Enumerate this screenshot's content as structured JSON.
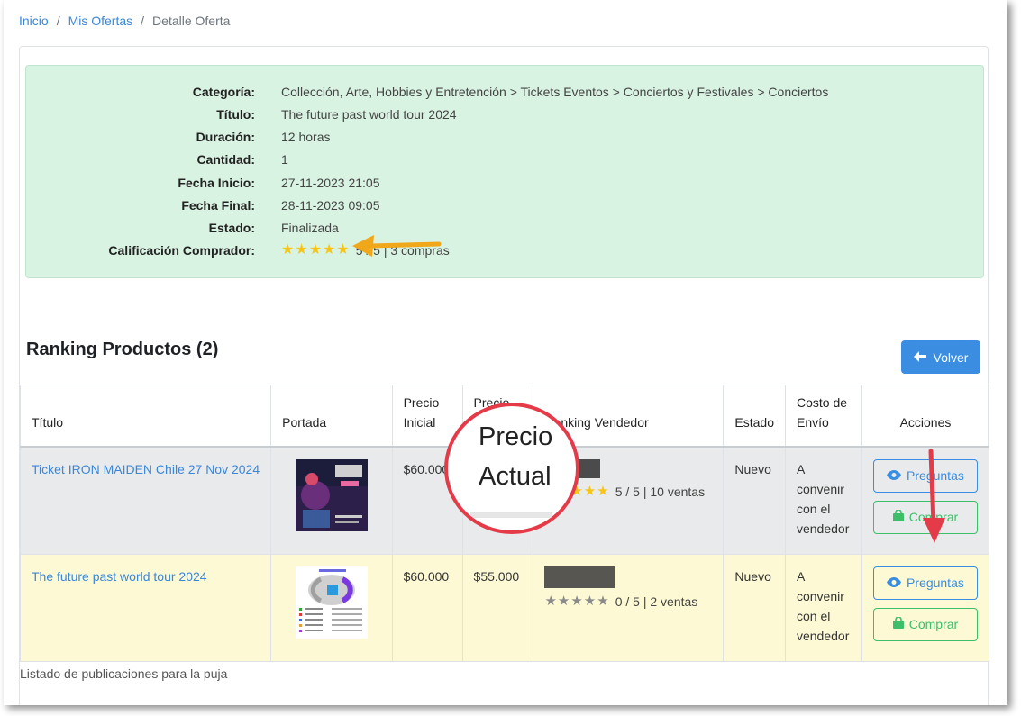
{
  "breadcrumb": {
    "home": "Inicio",
    "offers": "Mis Ofertas",
    "current": "Detalle Oferta"
  },
  "detail": {
    "rows": [
      {
        "label": "Categoría:",
        "value": "Collección, Arte, Hobbies y Entretención > Tickets Eventos > Conciertos y Festivales > Conciertos"
      },
      {
        "label": "Título:",
        "value": "The future past world tour 2024"
      },
      {
        "label": "Duración:",
        "value": "12 horas"
      },
      {
        "label": "Cantidad:",
        "value": "1"
      },
      {
        "label": "Fecha Inicio:",
        "value": "27-11-2023 21:05"
      },
      {
        "label": "Fecha Final:",
        "value": "28-11-2023 09:05"
      },
      {
        "label": "Estado:",
        "value": "Finalizada"
      },
      {
        "label": "Calificación Comprador:",
        "value": "5 / 5 | 3 compras"
      }
    ],
    "buyer_rating_stars": 5
  },
  "ranking": {
    "title": "Ranking Productos (2)",
    "back_button": "Volver",
    "columns": [
      "Título",
      "Portada",
      "Precio Inicial",
      "Precio Actual",
      "Ranking Vendedor",
      "Estado",
      "Costo de Envío",
      "Acciones"
    ],
    "rows": [
      {
        "title": "Ticket IRON MAIDEN Chile 27 Nov 2024",
        "start_price": "$60.000",
        "current_price": "",
        "seller_rating": "5 / 5 | 10 ventas",
        "seller_stars": 5,
        "state": "Nuevo",
        "shipping": "A convenir con el vendedor",
        "btn_questions": "Preguntas",
        "btn_buy": "Comprar"
      },
      {
        "title": "The future past world tour 2024",
        "start_price": "$60.000",
        "current_price": "$55.000",
        "seller_rating": "0 / 5 | 2 ventas",
        "seller_stars": 0,
        "state": "Nuevo",
        "shipping": "A convenir con el vendedor",
        "btn_questions": "Preguntas",
        "btn_buy": "Comprar"
      }
    ],
    "caption": "Listado de publicaciones para la puja"
  },
  "annotation": {
    "magnifier_line1": "Precio",
    "magnifier_line2": "Actual"
  },
  "colors": {
    "link": "#3a87d9",
    "primary": "#3a8de0",
    "success": "#3dbf6a",
    "highlight_row": "#fdf9d5",
    "detail_bg": "#d9f3e3",
    "annotation_red": "#e53b48",
    "annotation_orange": "#f0a71a"
  }
}
